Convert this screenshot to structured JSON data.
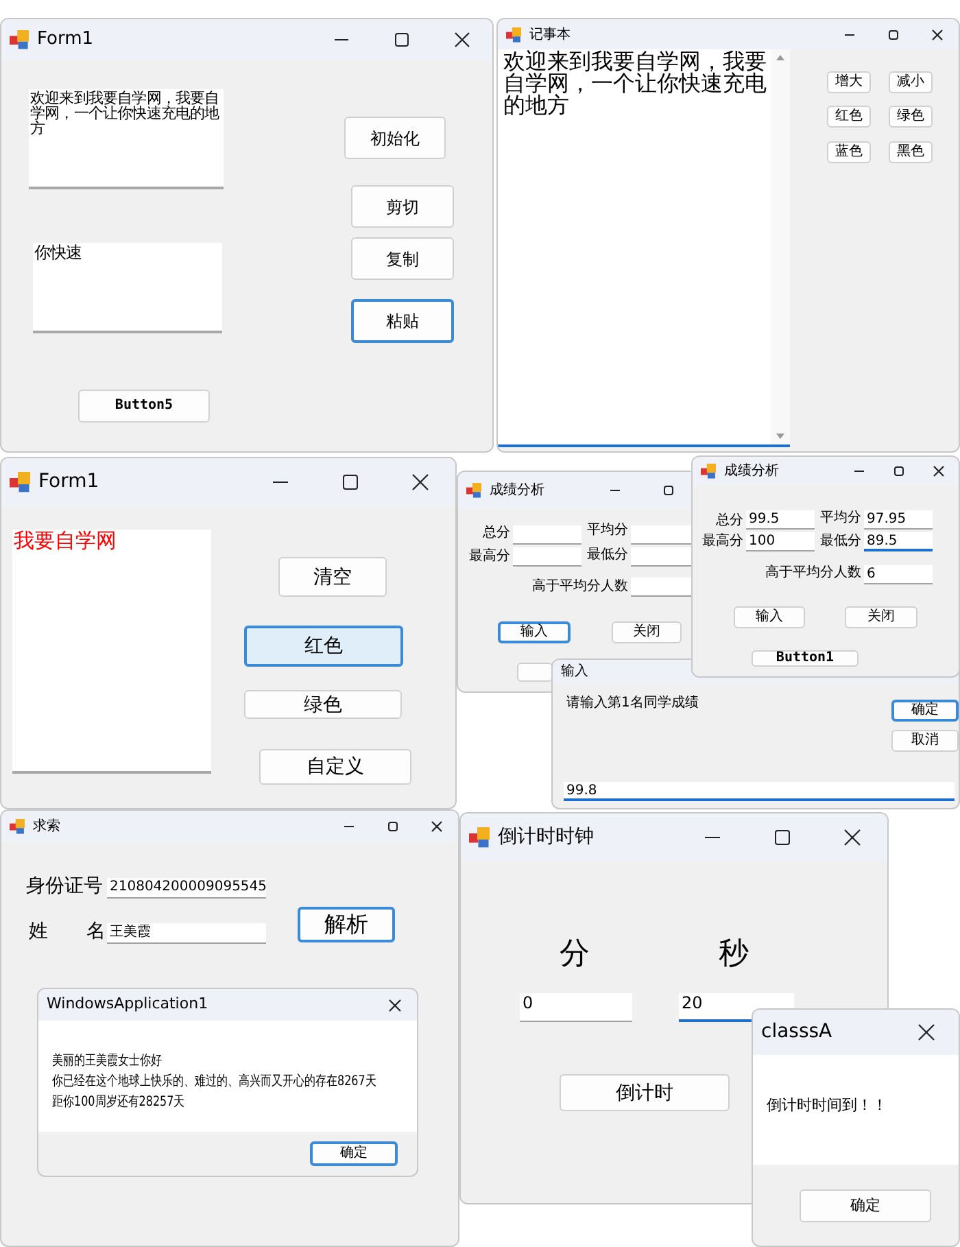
{
  "windows": [
    {
      "kind": "form",
      "title": "Form1",
      "icon": true,
      "caption_buttons": [
        {
          "kind": "minimize"
        },
        {
          "kind": "maximize"
        },
        {
          "kind": "close"
        }
      ],
      "controls": [
        {
          "kind": "textarea",
          "text": "欢迎来到我要自学网，我要自学网，一个让你快速充电的地方",
          "focused": false
        },
        {
          "kind": "textarea",
          "text": "你快速",
          "focused": false
        },
        {
          "kind": "button",
          "text": "初始化",
          "focused": false,
          "hovered": false
        },
        {
          "kind": "button",
          "text": "剪切",
          "focused": false,
          "hovered": false
        },
        {
          "kind": "button",
          "text": "复制",
          "focused": false,
          "hovered": false
        },
        {
          "kind": "button",
          "text": "粘贴",
          "focused": true,
          "hovered": false
        },
        {
          "kind": "button",
          "text": "Button5",
          "focused": false,
          "hovered": false
        }
      ]
    },
    {
      "kind": "form",
      "title": "记事本",
      "icon": true,
      "caption_buttons": [
        {
          "kind": "minimize"
        },
        {
          "kind": "maximize"
        },
        {
          "kind": "close"
        }
      ],
      "controls": [
        {
          "kind": "textarea",
          "text": "欢迎来到我要自学网，我要自学网，一个让你快速充电的地方",
          "focused": true
        },
        {
          "kind": "button",
          "text": "增大",
          "focused": false,
          "hovered": false
        },
        {
          "kind": "button",
          "text": "减小",
          "focused": false,
          "hovered": false
        },
        {
          "kind": "button",
          "text": "红色",
          "focused": false,
          "hovered": false
        },
        {
          "kind": "button",
          "text": "绿色",
          "focused": false,
          "hovered": false
        },
        {
          "kind": "button",
          "text": "蓝色",
          "focused": false,
          "hovered": false
        },
        {
          "kind": "button",
          "text": "黑色",
          "focused": false,
          "hovered": false
        }
      ]
    },
    {
      "kind": "form",
      "title": "Form1",
      "icon": true,
      "caption_buttons": [
        {
          "kind": "minimize"
        },
        {
          "kind": "maximize"
        },
        {
          "kind": "close"
        }
      ],
      "controls": [
        {
          "kind": "textarea",
          "text": "我要自学网",
          "color": "#ff0000",
          "focused": false
        },
        {
          "kind": "button",
          "text": "清空",
          "focused": false,
          "hovered": false
        },
        {
          "kind": "button",
          "text": "红色",
          "focused": true,
          "hovered": true
        },
        {
          "kind": "button",
          "text": "绿色",
          "focused": false,
          "hovered": false
        },
        {
          "kind": "button",
          "text": "自定义",
          "focused": false,
          "hovered": false
        }
      ]
    },
    {
      "kind": "form",
      "title": "成绩分析",
      "icon": true,
      "caption_buttons": [
        {
          "kind": "minimize"
        },
        {
          "kind": "maximize"
        }
      ],
      "controls": [
        {
          "kind": "label",
          "text": "总分"
        },
        {
          "kind": "textbox",
          "focused": false
        },
        {
          "kind": "label",
          "text": "平均分"
        },
        {
          "kind": "textbox",
          "focused": false
        },
        {
          "kind": "label",
          "text": "最高分"
        },
        {
          "kind": "textbox",
          "focused": false
        },
        {
          "kind": "label",
          "text": "最低分"
        },
        {
          "kind": "textbox",
          "focused": false
        },
        {
          "kind": "label",
          "text": "高于平均分人数"
        },
        {
          "kind": "textbox",
          "focused": false
        },
        {
          "kind": "button",
          "text": "输入",
          "focused": true,
          "hovered": false
        },
        {
          "kind": "button",
          "text": "关闭",
          "focused": false,
          "hovered": false
        },
        {
          "kind": "button",
          "focused": false,
          "hovered": false
        }
      ]
    },
    {
      "kind": "form",
      "title": "成绩分析",
      "icon": true,
      "caption_buttons": [
        {
          "kind": "minimize"
        },
        {
          "kind": "maximize"
        },
        {
          "kind": "close"
        }
      ],
      "controls": [
        {
          "kind": "label",
          "text": "总分"
        },
        {
          "kind": "textbox",
          "text": "99.5",
          "focused": false
        },
        {
          "kind": "label",
          "text": "平均分"
        },
        {
          "kind": "textbox",
          "text": "97.95",
          "focused": false
        },
        {
          "kind": "label",
          "text": "最高分"
        },
        {
          "kind": "textbox",
          "text": "100",
          "focused": false
        },
        {
          "kind": "label",
          "text": "最低分"
        },
        {
          "kind": "textbox",
          "text": "89.5",
          "focused": true
        },
        {
          "kind": "label",
          "text": "高于平均分人数"
        },
        {
          "kind": "textbox",
          "text": "6",
          "focused": false
        },
        {
          "kind": "button",
          "text": "输入",
          "focused": false,
          "hovered": false
        },
        {
          "kind": "button",
          "text": "关闭",
          "focused": false,
          "hovered": false
        },
        {
          "kind": "button",
          "text": "Button1",
          "focused": false,
          "hovered": false
        }
      ]
    },
    {
      "kind": "inputbox",
      "title": "输入",
      "icon": false,
      "controls": [
        {
          "kind": "label",
          "text": "请输入第1名同学成绩"
        },
        {
          "kind": "button",
          "text": "确定",
          "focused": true,
          "hovered": false
        },
        {
          "kind": "button",
          "text": "取消",
          "focused": false,
          "hovered": false
        },
        {
          "kind": "textbox",
          "text": "99.8",
          "focused": true
        }
      ]
    },
    {
      "kind": "form",
      "title": "求索",
      "icon": true,
      "caption_buttons": [
        {
          "kind": "minimize"
        },
        {
          "kind": "maximize"
        },
        {
          "kind": "close"
        }
      ],
      "controls": [
        {
          "kind": "label",
          "text": "身份证号"
        },
        {
          "kind": "textbox",
          "text": "210804200009095545",
          "focused": false
        },
        {
          "kind": "label",
          "text": "姓"
        },
        {
          "kind": "label",
          "text": "名"
        },
        {
          "kind": "textbox",
          "text": "王美霞",
          "focused": false
        },
        {
          "kind": "button",
          "text": "解析",
          "focused": true,
          "hovered": false
        }
      ]
    },
    {
      "kind": "messagebox",
      "title": "WindowsApplication1",
      "icon": false,
      "caption_buttons": [
        {
          "kind": "close"
        }
      ],
      "message_lines": [
        "美丽的王美霞女士你好",
        "你已经在这个地球上快乐的、难过的、高兴而又开心的存在8267天",
        "距你100周岁还有28257天"
      ],
      "controls": [
        {
          "kind": "button",
          "text": "确定",
          "focused": true,
          "hovered": false
        }
      ]
    },
    {
      "kind": "form",
      "title": "倒计时时钟",
      "icon": true,
      "caption_buttons": [
        {
          "kind": "minimize"
        },
        {
          "kind": "maximize"
        },
        {
          "kind": "close"
        }
      ],
      "controls": [
        {
          "kind": "label",
          "text": "分"
        },
        {
          "kind": "label",
          "text": "秒"
        },
        {
          "kind": "textbox",
          "text": "0",
          "focused": false
        },
        {
          "kind": "textbox",
          "text": "20",
          "focused": true
        },
        {
          "kind": "button",
          "text": "倒计时",
          "focused": false,
          "hovered": false
        }
      ]
    },
    {
      "kind": "messagebox",
      "title": "classsA",
      "icon": false,
      "caption_buttons": [
        {
          "kind": "close"
        }
      ],
      "message_lines": [
        "倒计时时间到！！"
      ],
      "controls": [
        {
          "kind": "button",
          "text": "确定",
          "focused": false,
          "hovered": false
        }
      ]
    }
  ]
}
